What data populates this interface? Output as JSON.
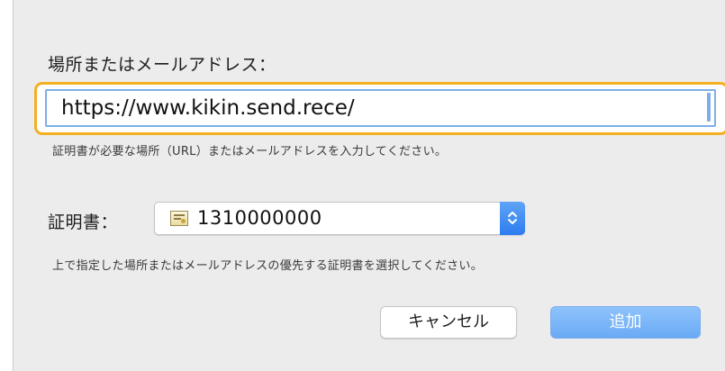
{
  "form": {
    "location_label": "場所またはメールアドレス：",
    "location_value": "https://www.kikin.send.rece/",
    "location_hint": "証明書が必要な場所（URL）またはメールアドレスを入力してください。",
    "certificate_label": "証明書：",
    "certificate_value": "1310000000",
    "certificate_hint": "上で指定した場所またはメールアドレスの優先する証明書を選択してください。"
  },
  "buttons": {
    "cancel_label": "キャンセル",
    "add_label": "追加"
  },
  "icons": {
    "certificate": "certificate-icon",
    "stepper": "up-down-chevron-icon"
  },
  "colors": {
    "focus_ring": "#f3b024",
    "accent_blue": "#4a90e2",
    "dialog_background": "#ececec"
  }
}
